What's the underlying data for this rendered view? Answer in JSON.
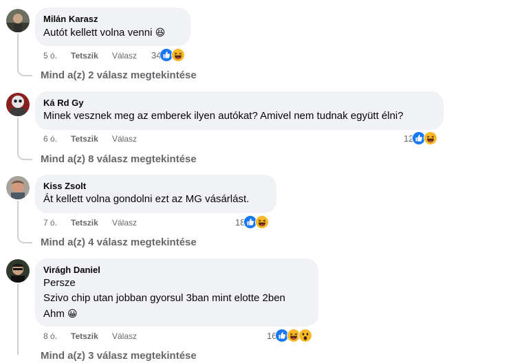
{
  "comments": [
    {
      "author": "Milán Karasz",
      "lines": [
        "Autót kellett volna venni"
      ],
      "emoji": "😆",
      "time": "5 ó.",
      "like_label": "Tetszik",
      "reply_label": "Válasz",
      "reaction_count": "34",
      "reactions": [
        "like-icon",
        "haha-icon"
      ],
      "replies_link": "Mind a(z) 2 válasz megtekintése"
    },
    {
      "author": "Ká Rd Gy",
      "lines": [
        "Minek vesznek meg az emberek ilyen autókat? Amivel nem tudnak együtt élni?"
      ],
      "time": "6 ó.",
      "like_label": "Tetszik",
      "reply_label": "Válasz",
      "reaction_count": "12",
      "reactions": [
        "like-icon",
        "haha-icon"
      ],
      "replies_link": "Mind a(z) 8 válasz megtekintése"
    },
    {
      "author": "Kiss Zsolt",
      "lines": [
        "Át kellett volna gondolni ezt az MG vásárlást."
      ],
      "time": "7 ó.",
      "like_label": "Tetszik",
      "reply_label": "Válasz",
      "reaction_count": "18",
      "reactions": [
        "like-icon",
        "haha-icon"
      ],
      "replies_link": "Mind a(z) 4 válasz megtekintése"
    },
    {
      "author": "Virágh Daniel",
      "lines": [
        "Persze",
        "Szivo chip utan jobban gyorsul 3ban mint elotte 2ben",
        "Ahm"
      ],
      "emoji": "😀",
      "time": "8 ó.",
      "like_label": "Tetszik",
      "reply_label": "Válasz",
      "reaction_count": "16",
      "reactions": [
        "like-icon",
        "haha-icon",
        "wow-icon"
      ],
      "replies_link": "Mind a(z) 3 válasz megtekintése"
    }
  ],
  "colors": {
    "like": "#1877f2",
    "haha": "#f7b928",
    "bubble": "#f0f2f5",
    "secondary_text": "#65676b"
  }
}
